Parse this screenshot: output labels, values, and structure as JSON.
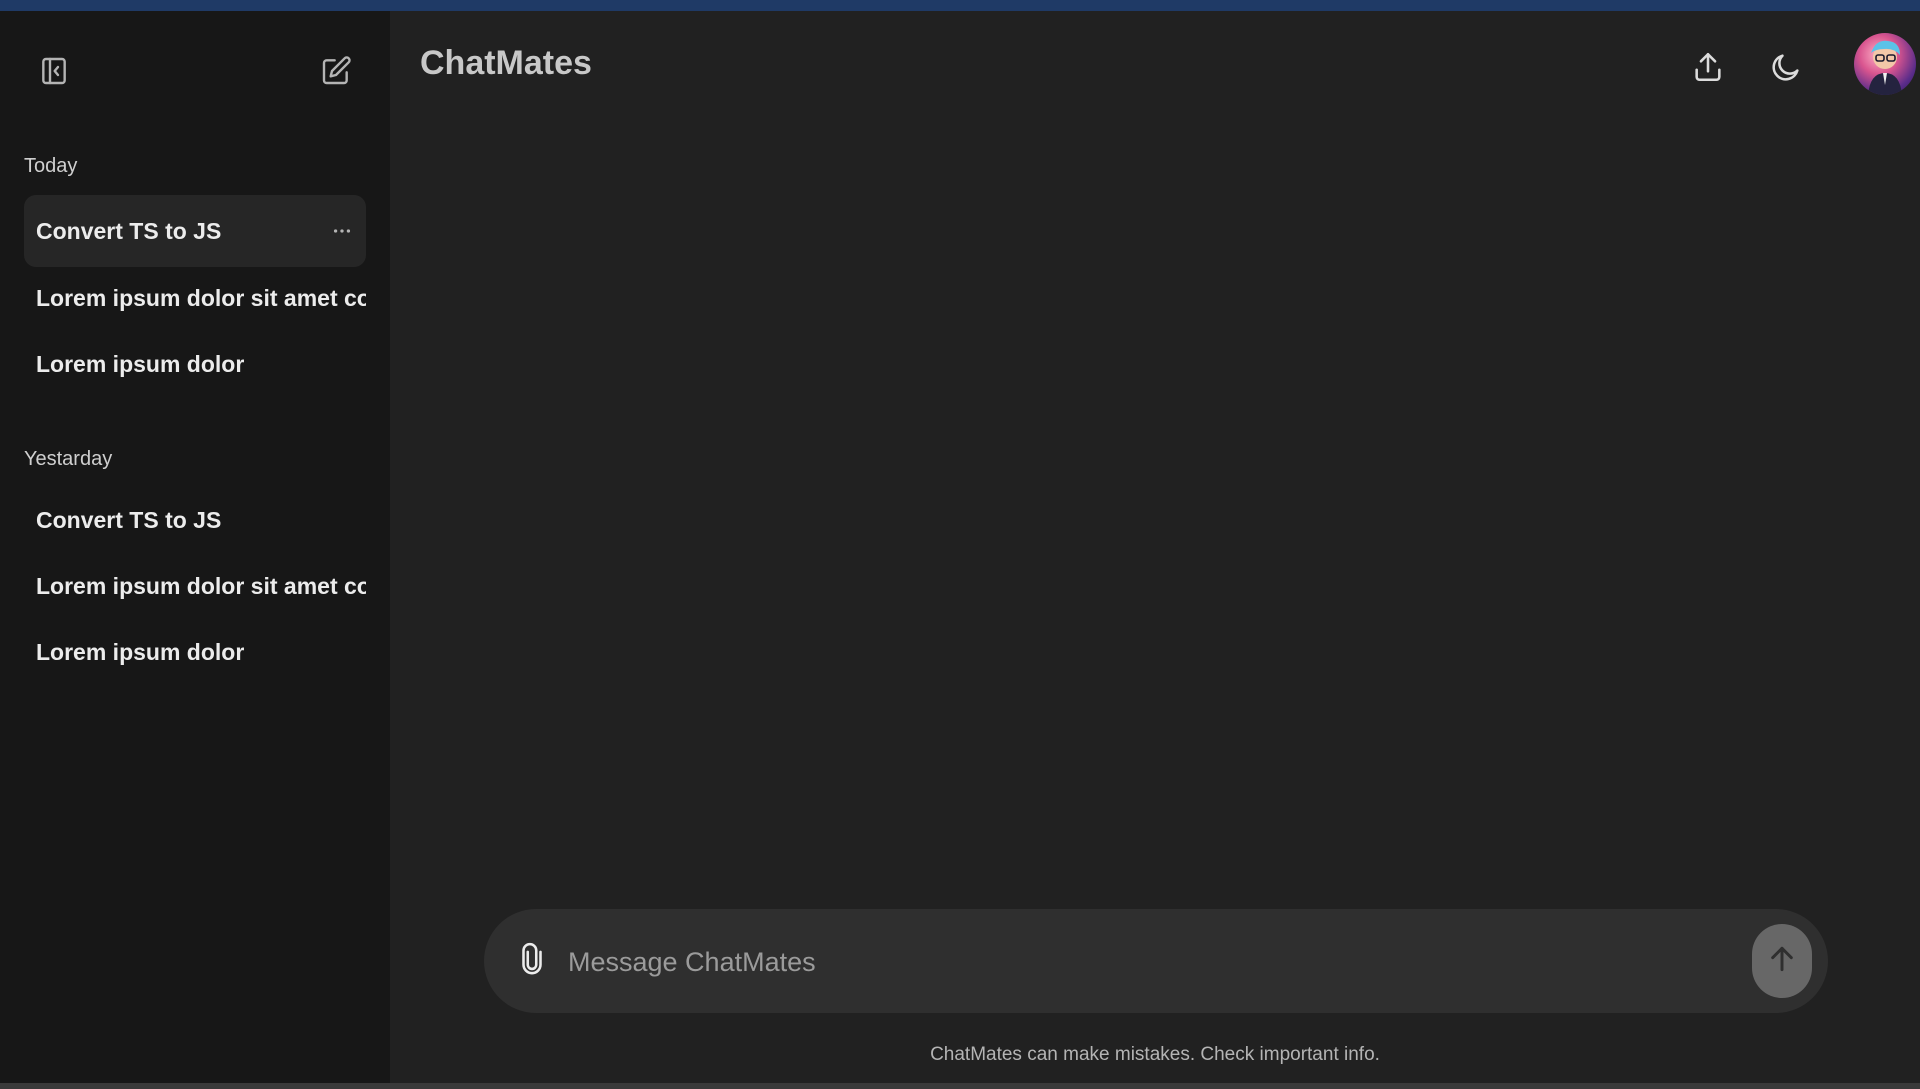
{
  "app": {
    "title": "ChatMates"
  },
  "sidebar": {
    "groups": [
      {
        "label": "Today",
        "items": [
          {
            "label": "Convert TS to JS",
            "active": true
          },
          {
            "label": "Lorem ipsum dolor sit amet consec"
          },
          {
            "label": "Lorem ipsum dolor"
          }
        ]
      },
      {
        "label": "Yestarday",
        "items": [
          {
            "label": "Convert TS to JS"
          },
          {
            "label": "Lorem ipsum dolor sit amet consec"
          },
          {
            "label": "Lorem ipsum dolor"
          }
        ]
      }
    ],
    "icons": {
      "toggle": "sidebar-toggle-icon",
      "new_chat": "edit-icon",
      "more": "more-horizontal-icon"
    }
  },
  "header": {
    "icons": {
      "share": "upload-icon",
      "theme": "moon-icon"
    }
  },
  "composer": {
    "placeholder": "Message ChatMates",
    "icons": {
      "attach": "paperclip-icon",
      "send": "arrow-up-icon"
    }
  },
  "footer": {
    "disclaimer": "ChatMates can make mistakes. Check important info."
  },
  "colors": {
    "sidebar_bg": "#171717",
    "main_bg": "#212121",
    "composer_bg": "#2f2f2f",
    "active_item_bg": "#262626",
    "send_button_bg": "#676767",
    "top_accent": "#1f3a66"
  }
}
